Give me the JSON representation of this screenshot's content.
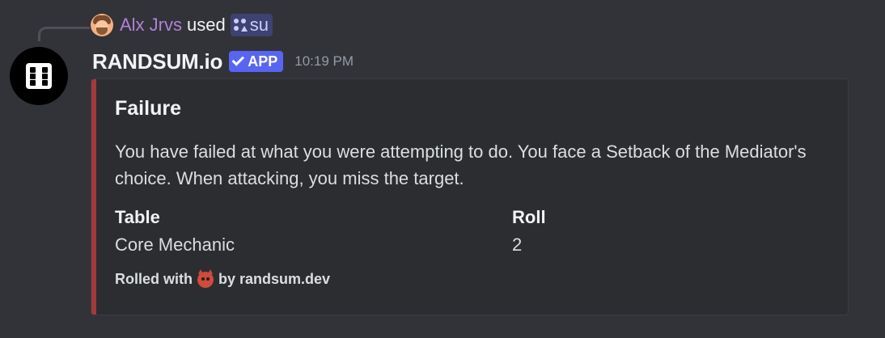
{
  "interaction": {
    "user_name": "Alx Jrvs",
    "used_text": "used",
    "command": "su"
  },
  "message": {
    "author": "RANDSUM.io",
    "badge": "APP",
    "timestamp": "10:19 PM"
  },
  "embed": {
    "accent_color": "#a33a3a",
    "title": "Failure",
    "description": "You have failed at what you were attempting to do. You face a Setback of the Mediator's choice. When attacking, you miss the target.",
    "fields": [
      {
        "name": "Table",
        "value": "Core Mechanic"
      },
      {
        "name": "Roll",
        "value": "2"
      }
    ],
    "footer_prefix": "Rolled with",
    "footer_icon": "devil-emoji",
    "footer_suffix": "by randsum.dev"
  },
  "colors": {
    "background": "#323339",
    "username": "#b181d6",
    "app_badge": "#5865f2"
  }
}
